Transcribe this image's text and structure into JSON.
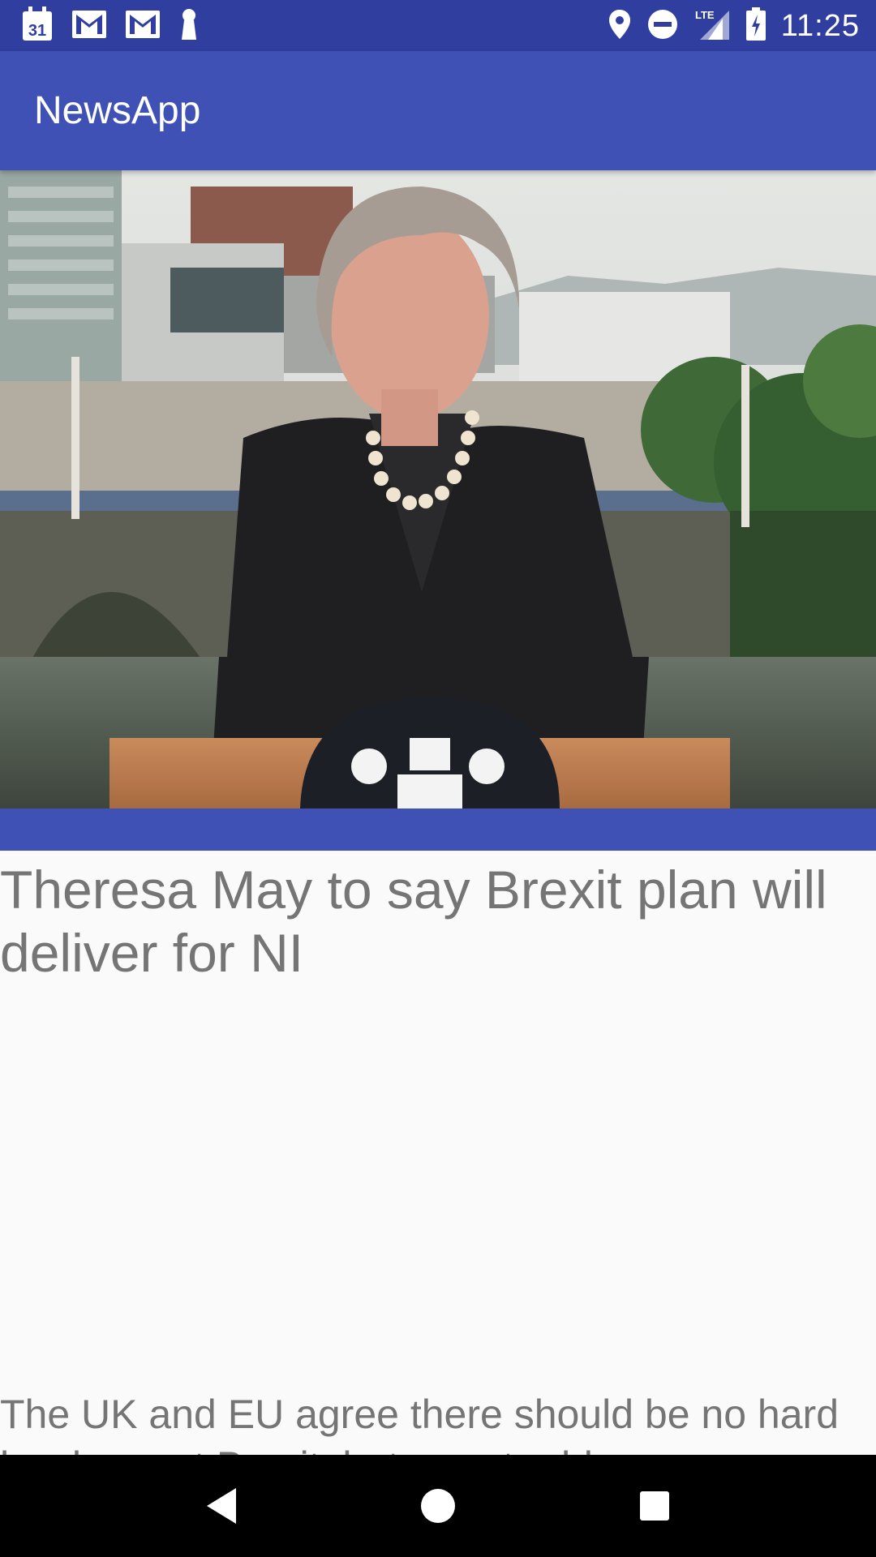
{
  "status_bar": {
    "time": "11:25",
    "calendar_day": "31",
    "network_label": "LTE",
    "left_icons": [
      "calendar-icon",
      "gmail-icon",
      "gmail-icon",
      "keyhole-icon"
    ],
    "right_icons": [
      "location-icon",
      "do-not-disturb-icon",
      "signal-icon",
      "battery-icon"
    ]
  },
  "app_bar": {
    "title": "NewsApp"
  },
  "article": {
    "headline": "Theresa May to say Brexit plan will deliver for NI",
    "summary": "The UK and EU agree there should be no hard border post Brexit, but are at odds on"
  },
  "nav": {
    "buttons": [
      "back-icon",
      "home-icon",
      "recents-icon"
    ]
  },
  "colors": {
    "primary": "#3f51b5",
    "primary_dark": "#303f9f",
    "text_secondary": "#757575",
    "background": "#fafafa"
  }
}
